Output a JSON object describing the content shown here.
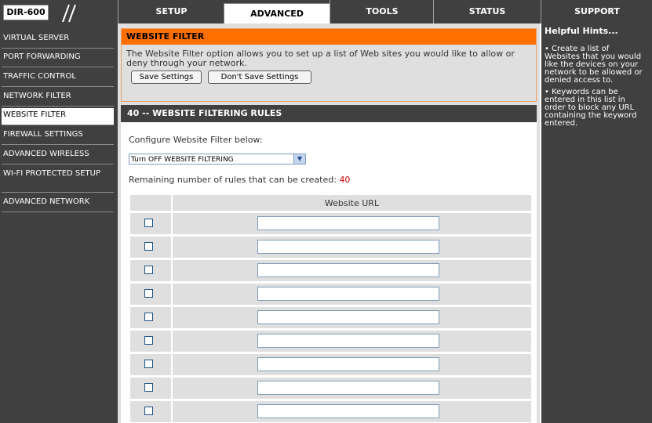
{
  "header": {
    "model": "DIR-600",
    "tabs": [
      {
        "label": "SETUP"
      },
      {
        "label": "ADVANCED"
      },
      {
        "label": "TOOLS"
      },
      {
        "label": "STATUS"
      },
      {
        "label": "SUPPORT"
      }
    ],
    "active_tab": "ADVANCED"
  },
  "sidebar": {
    "items": [
      {
        "label": "VIRTUAL SERVER"
      },
      {
        "label": "PORT FORWARDING"
      },
      {
        "label": "TRAFFIC CONTROL"
      },
      {
        "label": "NETWORK FILTER"
      },
      {
        "label": "WEBSITE FILTER"
      },
      {
        "label": "FIREWALL SETTINGS"
      },
      {
        "label": "ADVANCED WIRELESS"
      },
      {
        "label": "WI-FI PROTECTED SETUP"
      },
      {
        "label": "ADVANCED NETWORK"
      }
    ],
    "active": "WEBSITE FILTER"
  },
  "website_filter": {
    "title": "WEBSITE FILTER",
    "description": "The Website Filter option allows you to set up a list of Web sites you would like to allow or deny through your network.",
    "save_label": "Save Settings",
    "dont_save_label": "Don't Save Settings"
  },
  "rules": {
    "title": "40 -- WEBSITE FILTERING RULES",
    "configure_label": "Configure Website Filter below:",
    "select_value": "Turn OFF WEBSITE FILTERING",
    "remaining_label": "Remaining number of rules that can be created:",
    "remaining_count": "40",
    "column_header": "Website URL",
    "visible_rows": 9
  },
  "support": {
    "title": "Helpful Hints...",
    "hints": [
      "• Create a list of Websites that you would like the devices on your network to be allowed or denied access to.",
      "• Keywords can be entered in this list in order to block any URL containing the keyword entered."
    ]
  },
  "colors": {
    "nav_bg": "#404040",
    "section_head": "#ff6f00",
    "remaining_count": "#cc0000"
  }
}
